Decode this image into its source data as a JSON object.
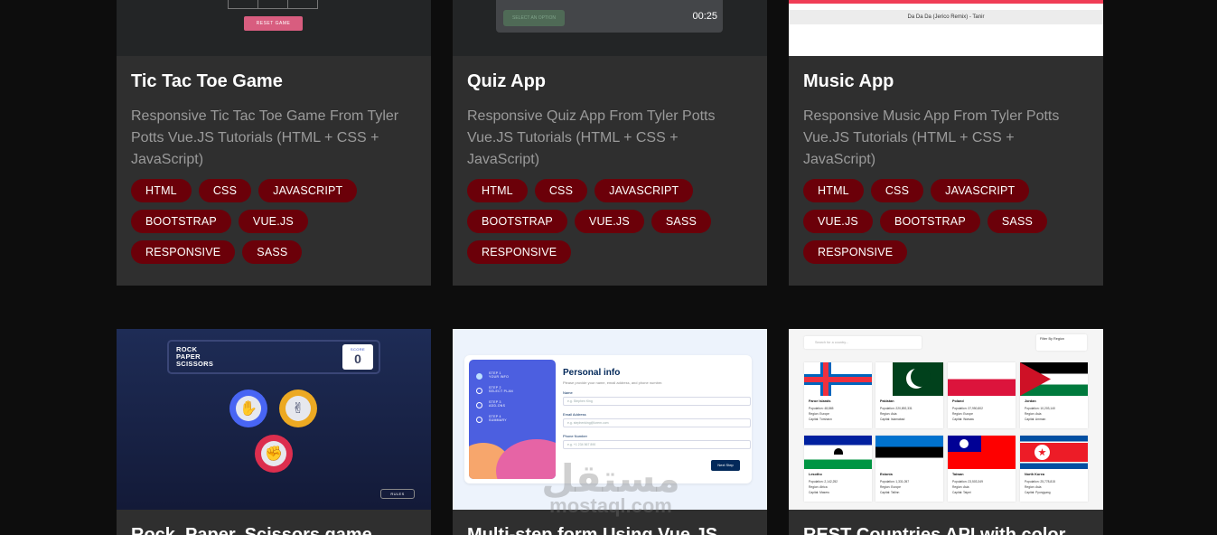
{
  "projects": [
    {
      "title": "Tic Tac Toe Game",
      "description": "Responsive Tic Tac Toe Game From Tyler Potts Vue.JS Tutorials (HTML + CSS + JavaScript)",
      "tags": [
        "HTML",
        "CSS",
        "JAVASCRIPT",
        "BOOTSTRAP",
        "VUE.JS",
        "RESPONSIVE",
        "SASS"
      ],
      "preview": {
        "button_label": "RESET GAME"
      }
    },
    {
      "title": "Quiz App",
      "description": "Responsive Quiz App From Tyler Potts Vue.JS Tutorials (HTML + CSS + JavaScript)",
      "tags": [
        "HTML",
        "CSS",
        "JAVASCRIPT",
        "BOOTSTRAP",
        "VUE.JS",
        "SASS",
        "RESPONSIVE"
      ],
      "preview": {
        "option_label": "SELECT AN OPTION",
        "timer": "00:25"
      }
    },
    {
      "title": "Music App",
      "description": "Responsive Music App From Tyler Potts Vue.JS Tutorials (HTML + CSS + JavaScript)",
      "tags": [
        "HTML",
        "CSS",
        "JAVASCRIPT",
        "VUE.JS",
        "BOOTSTRAP",
        "SASS",
        "RESPONSIVE"
      ],
      "preview": {
        "now_playing": "Da Da Da (Jerico Remix) - Tanir"
      }
    },
    {
      "title": "Rock, Paper, Scissors game",
      "preview": {
        "game_title_lines": [
          "ROCK",
          "PAPER",
          "SCISSORS"
        ],
        "score_label": "SCORE",
        "score_value": "0",
        "rules_label": "RULES"
      }
    },
    {
      "title": "Multi-step form Using Vue.JS",
      "preview": {
        "steps": [
          {
            "num": "1",
            "small": "STEP 1",
            "label": "YOUR INFO"
          },
          {
            "num": "2",
            "small": "STEP 2",
            "label": "SELECT PLAN"
          },
          {
            "num": "3",
            "small": "STEP 3",
            "label": "ADD-ONS"
          },
          {
            "num": "4",
            "small": "STEP 4",
            "label": "SUMMARY"
          }
        ],
        "heading": "Personal info",
        "subheading": "Please provide your name, email address, and phone number.",
        "fields": [
          {
            "label": "Name",
            "placeholder": "e.g. Stephen King"
          },
          {
            "label": "Email Address",
            "placeholder": "e.g. stephenking@lorem.com"
          },
          {
            "label": "Phone Number",
            "placeholder": "e.g. +1 234 567 890"
          }
        ],
        "next_label": "Next Step"
      }
    },
    {
      "title": "REST Countries API with color",
      "preview": {
        "search_placeholder": "Search for a country...",
        "filter_label": "Filter By Region",
        "countries": [
          {
            "name": "Faroe Islands",
            "population": "Population: 48,865",
            "region": "Region: Europe",
            "capital": "Capital: Tórshavn"
          },
          {
            "name": "Pakistan",
            "population": "Population: 220,892,331",
            "region": "Region: Asia",
            "capital": "Capital: Islamabad"
          },
          {
            "name": "Poland",
            "population": "Population: 37,950,802",
            "region": "Region: Europe",
            "capital": "Capital: Warsaw"
          },
          {
            "name": "Jordan",
            "population": "Population: 10,203,140",
            "region": "Region: Asia",
            "capital": "Capital: Amman"
          },
          {
            "name": "Lesotho",
            "population": "Population: 2,142,252",
            "region": "Region: Africa",
            "capital": "Capital: Maseru"
          },
          {
            "name": "Estonia",
            "population": "Population: 1,331,057",
            "region": "Region: Europe",
            "capital": "Capital: Tallinn"
          },
          {
            "name": "Taiwan",
            "population": "Population: 23,503,349",
            "region": "Region: Asia",
            "capital": "Capital: Taipei"
          },
          {
            "name": "North Korea",
            "population": "Population: 25,778,815",
            "region": "Region: Asia",
            "capital": "Capital: Pyongyang"
          }
        ]
      }
    }
  ],
  "watermark": {
    "arabic": "مستقل",
    "latin": "mostaql.com"
  },
  "colors": {
    "page_bg": "#0d0d0d",
    "card_bg": "#2f2f2f",
    "tag_bg": "#6b0009",
    "title": "#ffffff",
    "description": "#9a9a9a"
  }
}
